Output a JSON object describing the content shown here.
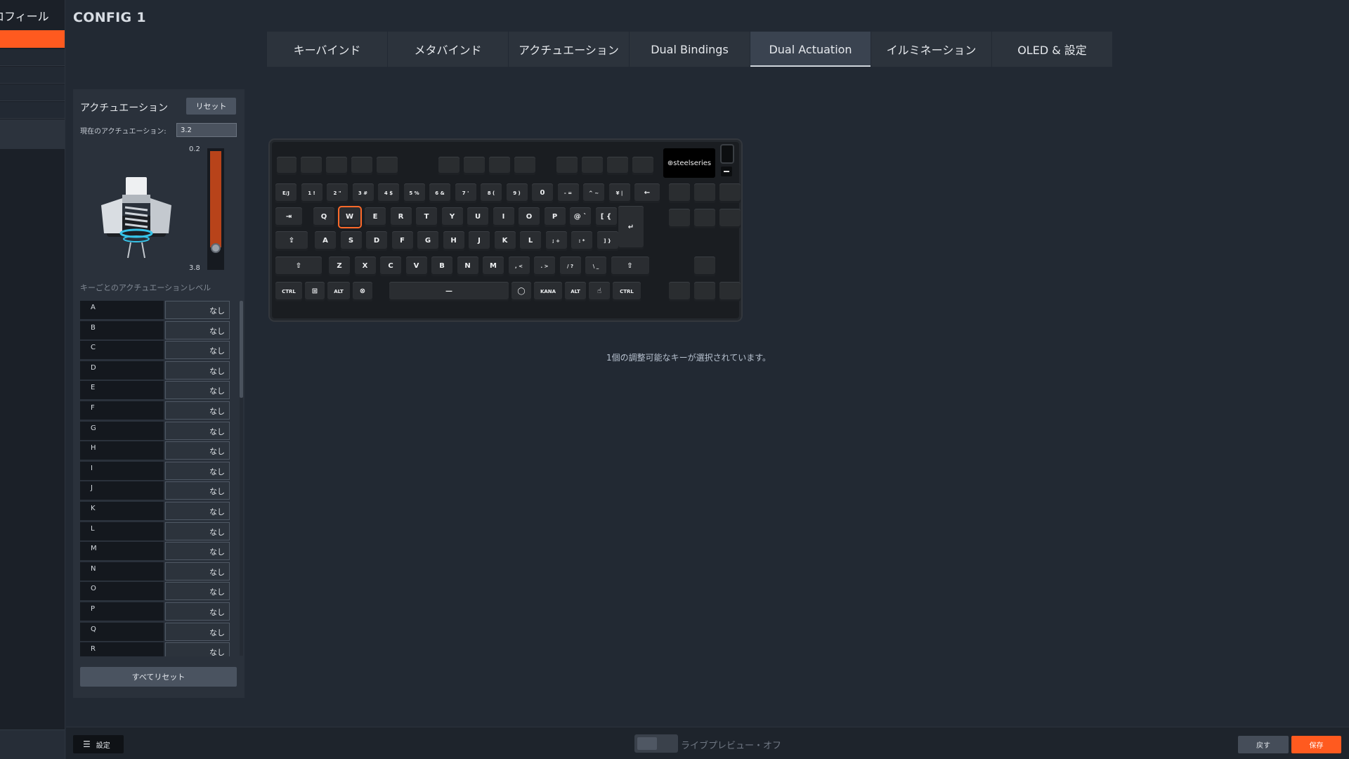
{
  "sidebar": {
    "title": "ロフィール"
  },
  "config": {
    "title": "CONFIG 1"
  },
  "tabs": [
    {
      "label": "キーバインド",
      "active": false
    },
    {
      "label": "メタバインド",
      "active": false
    },
    {
      "label": "アクチュエーション",
      "active": false
    },
    {
      "label": "Dual Bindings",
      "active": false
    },
    {
      "label": "Dual Actuation",
      "active": true
    },
    {
      "label": "イルミネーション",
      "active": false
    },
    {
      "label": "OLED & 設定",
      "active": false
    }
  ],
  "panel": {
    "title": "アクチュエーション",
    "reset_label": "リセット",
    "current_label": "現在のアクチュエーション:",
    "current_value": "3.2",
    "slider_min_label": "0.2",
    "slider_max_label": "3.8",
    "slider_level": 0.83,
    "per_key_label": "キーごとのアクチュエーションレベル",
    "reset_all_label": "すべてリセット",
    "keys": [
      {
        "name": "A",
        "value": "なし"
      },
      {
        "name": "B",
        "value": "なし"
      },
      {
        "name": "C",
        "value": "なし"
      },
      {
        "name": "D",
        "value": "なし"
      },
      {
        "name": "E",
        "value": "なし"
      },
      {
        "name": "F",
        "value": "なし"
      },
      {
        "name": "G",
        "value": "なし"
      },
      {
        "name": "H",
        "value": "なし"
      },
      {
        "name": "I",
        "value": "なし"
      },
      {
        "name": "J",
        "value": "なし"
      },
      {
        "name": "K",
        "value": "なし"
      },
      {
        "name": "L",
        "value": "なし"
      },
      {
        "name": "M",
        "value": "なし"
      },
      {
        "name": "N",
        "value": "なし"
      },
      {
        "name": "O",
        "value": "なし"
      },
      {
        "name": "P",
        "value": "なし"
      },
      {
        "name": "Q",
        "value": "なし"
      },
      {
        "name": "R",
        "value": "なし"
      }
    ]
  },
  "keyboard": {
    "logo": "⊕steelseries",
    "selected_key": "W",
    "rows": [
      [
        "E/J",
        "1 !",
        "2 \"",
        "3 #",
        "4 $",
        "5 %",
        "6 &",
        "7 '",
        "8 (",
        "9 )",
        "0",
        "- =",
        "^ ~",
        "¥ |",
        "←"
      ],
      [
        "⇥",
        "Q",
        "W",
        "E",
        "R",
        "T",
        "Y",
        "U",
        "I",
        "O",
        "P",
        "@ `",
        "[ {",
        "↵"
      ],
      [
        "⇪",
        "A",
        "S",
        "D",
        "F",
        "G",
        "H",
        "J",
        "K",
        "L",
        "; +",
        ": *",
        "] }"
      ],
      [
        "⇧",
        "Z",
        "X",
        "C",
        "V",
        "B",
        "N",
        "M",
        ", <",
        ". >",
        "/ ?",
        "\\ _",
        "⇧"
      ],
      [
        "CTRL",
        "⊞",
        "ALT",
        "⊗",
        "—",
        "◯",
        "KANA",
        "ALT",
        "☝",
        "CTRL"
      ]
    ]
  },
  "selection_info": "1個の調整可能なキーが選択されています。",
  "bottom": {
    "settings_label": "設定",
    "live_preview_label": "ライブプレビュー・オフ",
    "back_label": "戻す",
    "save_label": "保存"
  },
  "colors": {
    "accent": "#ff5a1f",
    "background": "#222933",
    "panel": "#2a313b"
  }
}
